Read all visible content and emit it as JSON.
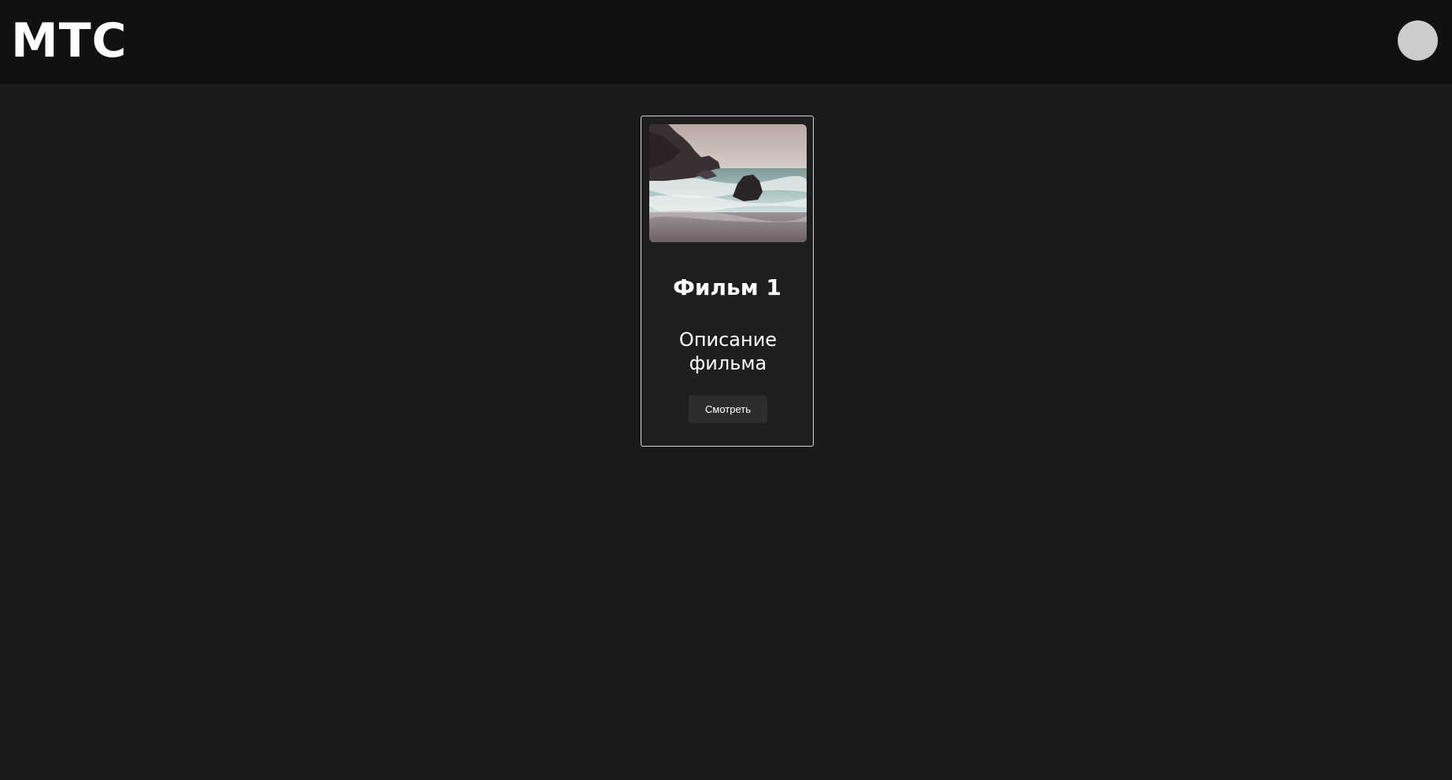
{
  "header": {
    "logo": "МТС",
    "avatar_icon": "user-avatar-icon"
  },
  "card": {
    "poster_icon": "seascape-image",
    "title": "Фильм 1",
    "description": "Описание фильма",
    "button_label": "Смотреть"
  },
  "colors": {
    "page_background": "#1b1b1b",
    "header_background": "#111111",
    "avatar": "#cccccc",
    "card_border": "#d6d6d6",
    "button_background": "#2d2d2d",
    "text": "#ffffff"
  }
}
